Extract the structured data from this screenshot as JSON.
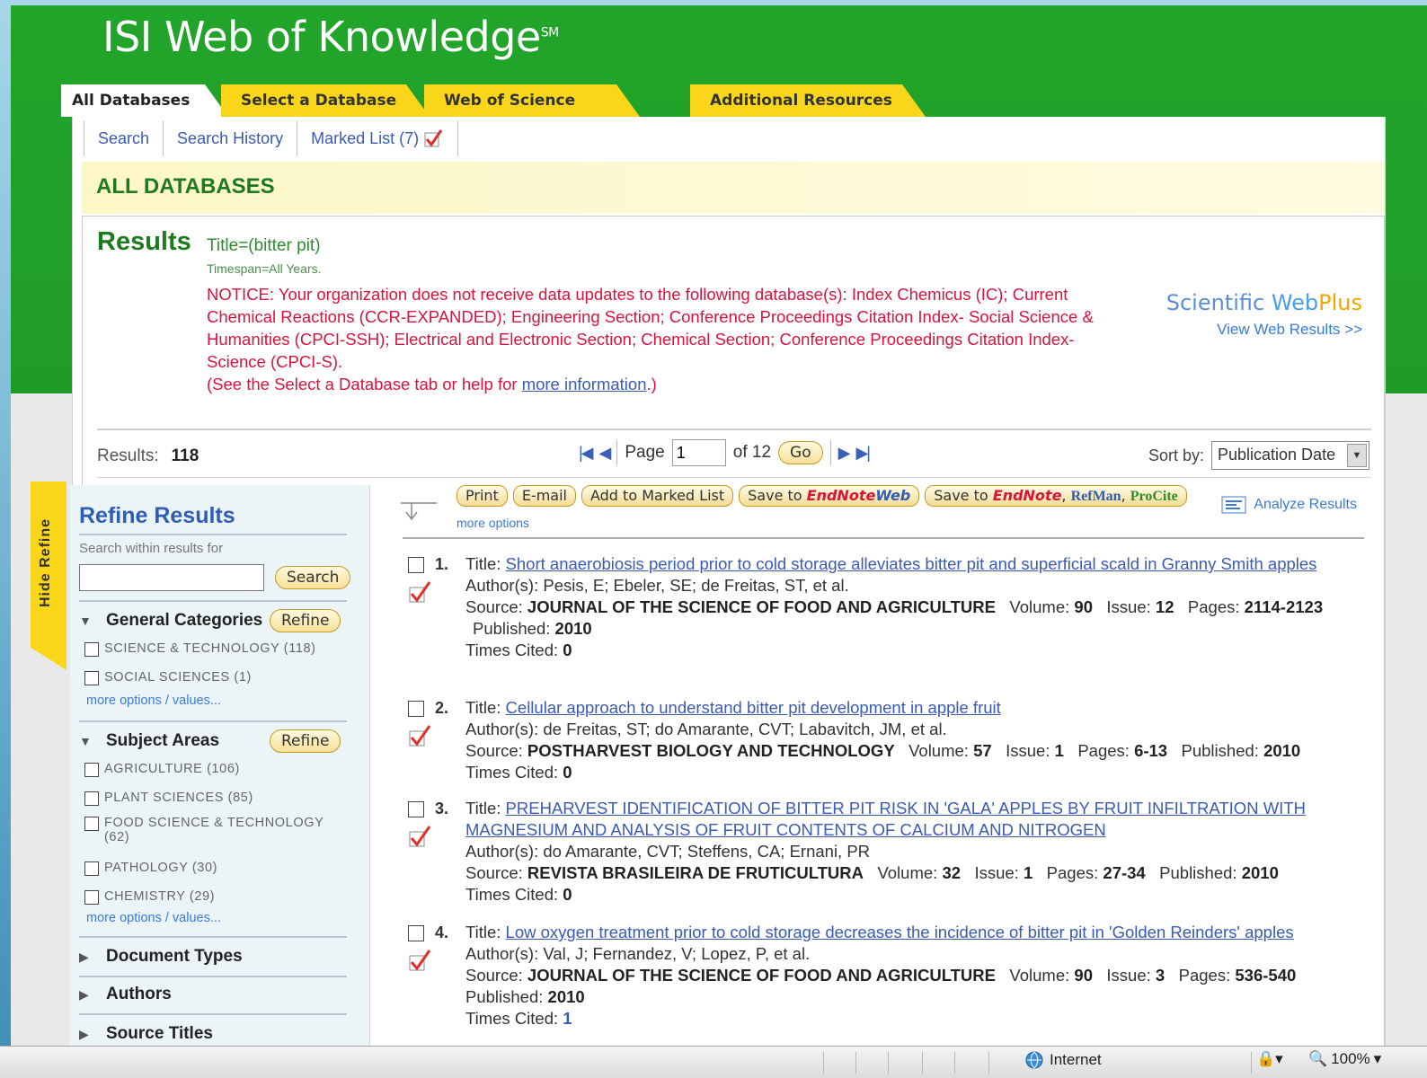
{
  "app": {
    "title": "ISI Web of Knowledge",
    "trademark": "SM"
  },
  "tabs": [
    {
      "label": "All Databases",
      "active": true
    },
    {
      "label": "Select a Database"
    },
    {
      "label": "Web of Science"
    },
    {
      "label": "Additional Resources"
    }
  ],
  "subnav": {
    "search": "Search",
    "history": "Search History",
    "marked": "Marked List (7)"
  },
  "banner": "ALL DATABASES",
  "results": {
    "heading": "Results",
    "query": "Title=(bitter pit)",
    "timespan": "Timespan=All Years.",
    "notice": "NOTICE: Your organization does not receive data updates to the following database(s): Index Chemicus (IC); Current Chemical Reactions (CCR-EXPANDED); Engineering Section; Conference Proceedings Citation Index- Social Science & Humanities (CPCI-SSH); Electrical and Electronic Section; Chemical Section; Conference Proceedings Citation Index- Science (CPCI-S).",
    "notice_see_pre": "(See the Select a Database tab or help for ",
    "notice_see_link": "more information",
    "notice_see_post": ".)",
    "count_label": "Results:",
    "count": "118"
  },
  "webplus": {
    "logo_a": "Scientific ",
    "logo_b": "Web",
    "logo_c": "Plus",
    "view": "View Web Results >>"
  },
  "pager": {
    "page_label": "Page",
    "page_value": "1",
    "of": "of 12",
    "go": "Go"
  },
  "sort": {
    "label": "Sort by:",
    "value": "Publication Date"
  },
  "refine": {
    "hide_label": "Hide Refine",
    "title": "Refine Results",
    "search_label": "Search within results for",
    "search_btn": "Search",
    "refine_btn": "Refine",
    "general_title": "General Categories",
    "general": [
      "SCIENCE & TECHNOLOGY (118)",
      "SOCIAL SCIENCES (1)"
    ],
    "subject_title": "Subject Areas",
    "subjects": [
      "AGRICULTURE (106)",
      "PLANT SCIENCES (85)",
      "FOOD SCIENCE & TECHNOLOGY (62)",
      "PATHOLOGY (30)",
      "CHEMISTRY (29)"
    ],
    "more": "more options / values...",
    "collapsed": [
      "Document Types",
      "Authors",
      "Source Titles"
    ]
  },
  "actions": {
    "print": "Print",
    "email": "E-mail",
    "add_marked": "Add to Marked List",
    "save_endnote_web_pre": "Save to ",
    "save_endnote_web_brand": "EndNote",
    "save_endnote_web_post": "Web",
    "save_multi_pre": "Save to ",
    "save_multi_endnote": "EndNote",
    "save_multi_refman": "RefMan",
    "save_multi_procite": "ProCite",
    "more_options": "more options",
    "analyze": "Analyze Results"
  },
  "records": [
    {
      "num": "1.",
      "title": "Short anaerobiosis period prior to cold storage alleviates bitter pit and superficial scald in Granny Smith apples",
      "authors": "Pesis, E; Ebeler, SE; de Freitas, ST, et al.",
      "source": "JOURNAL OF THE SCIENCE OF FOOD AND AGRICULTURE",
      "volume": "90",
      "issue": "12",
      "pages": "2114-2123",
      "published": "2010",
      "cited": "0"
    },
    {
      "num": "2.",
      "title": "Cellular approach to understand bitter pit development in apple fruit",
      "authors": "de Freitas, ST; do Amarante, CVT; Labavitch, JM, et al.",
      "source": "POSTHARVEST BIOLOGY AND TECHNOLOGY",
      "volume": "57",
      "issue": "1",
      "pages": "6-13",
      "published": "2010",
      "cited": "0"
    },
    {
      "num": "3.",
      "title": "PREHARVEST IDENTIFICATION OF BITTER PIT RISK IN 'GALA' APPLES BY FRUIT INFILTRATION WITH MAGNESIUM AND ANALYSIS OF FRUIT CONTENTS OF CALCIUM AND NITROGEN",
      "authors": "do Amarante, CVT; Steffens, CA; Ernani, PR",
      "source": "REVISTA BRASILEIRA DE FRUTICULTURA",
      "volume": "32",
      "issue": "1",
      "pages": "27-34",
      "published": "2010",
      "cited": "0"
    },
    {
      "num": "4.",
      "title": "Low oxygen treatment prior to cold storage decreases the incidence of bitter pit in 'Golden Reinders' apples",
      "authors": "Val, J; Fernandez, V; Lopez, P, et al.",
      "source": "JOURNAL OF THE SCIENCE OF FOOD AND AGRICULTURE",
      "volume": "90",
      "issue": "3",
      "pages": "536-540",
      "published": "2010",
      "cited": "1"
    }
  ],
  "labels": {
    "title": "Title: ",
    "authors": "Author(s): ",
    "source": "Source: ",
    "volume": "Volume: ",
    "issue": "Issue: ",
    "pages": "Pages: ",
    "published": "Published: ",
    "cited": "Times Cited: "
  },
  "status": {
    "zone": "Internet",
    "zoom": "100%"
  }
}
